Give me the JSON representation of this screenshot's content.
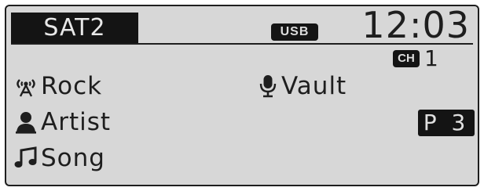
{
  "header": {
    "source": "SAT2",
    "usb_badge": "USB",
    "clock": "12:03"
  },
  "channel": {
    "badge": "CH",
    "number": "1"
  },
  "info": {
    "genre": {
      "icon": "satellite-antenna-icon",
      "label": "Rock"
    },
    "artist": {
      "icon": "artist-person-icon",
      "label": "Artist"
    },
    "song": {
      "icon": "music-note-icon",
      "label": "Song"
    },
    "category": {
      "icon": "microphone-icon",
      "label": "Vault"
    }
  },
  "preset": {
    "label": "P 3"
  },
  "colors": {
    "screen_background": "#d7d7d7",
    "foreground": "#1e1e1e",
    "badge_background": "#141414",
    "badge_text": "#dcdcdc"
  }
}
